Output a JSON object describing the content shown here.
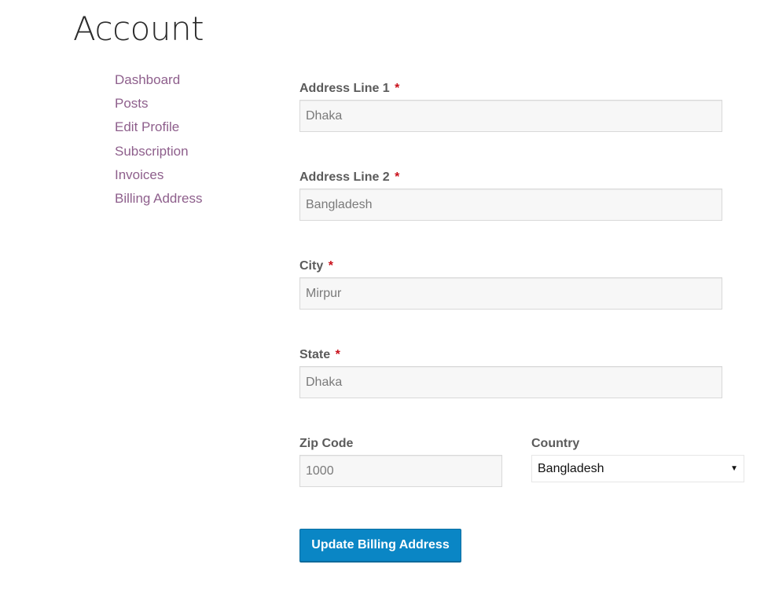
{
  "page": {
    "title": "Account"
  },
  "nav": {
    "items": [
      {
        "label": "Dashboard"
      },
      {
        "label": "Posts"
      },
      {
        "label": "Edit Profile"
      },
      {
        "label": "Subscription"
      },
      {
        "label": "Invoices"
      },
      {
        "label": "Billing Address"
      }
    ],
    "link_color": "#8e5f8c"
  },
  "form": {
    "required_marker": "*",
    "address_line_1": {
      "label": "Address Line 1",
      "value": "Dhaka"
    },
    "address_line_2": {
      "label": "Address Line 2",
      "value": "Bangladesh"
    },
    "city": {
      "label": "City",
      "value": "Mirpur"
    },
    "state": {
      "label": "State",
      "value": "Dhaka"
    },
    "zip_code": {
      "label": "Zip Code",
      "value": "1000"
    },
    "country": {
      "label": "Country",
      "selected": "Bangladesh",
      "icon": "dropdown-arrow-icon"
    },
    "submit_label": "Update Billing Address",
    "accent_color": "#0a86c5",
    "required_color": "#c9101a"
  }
}
